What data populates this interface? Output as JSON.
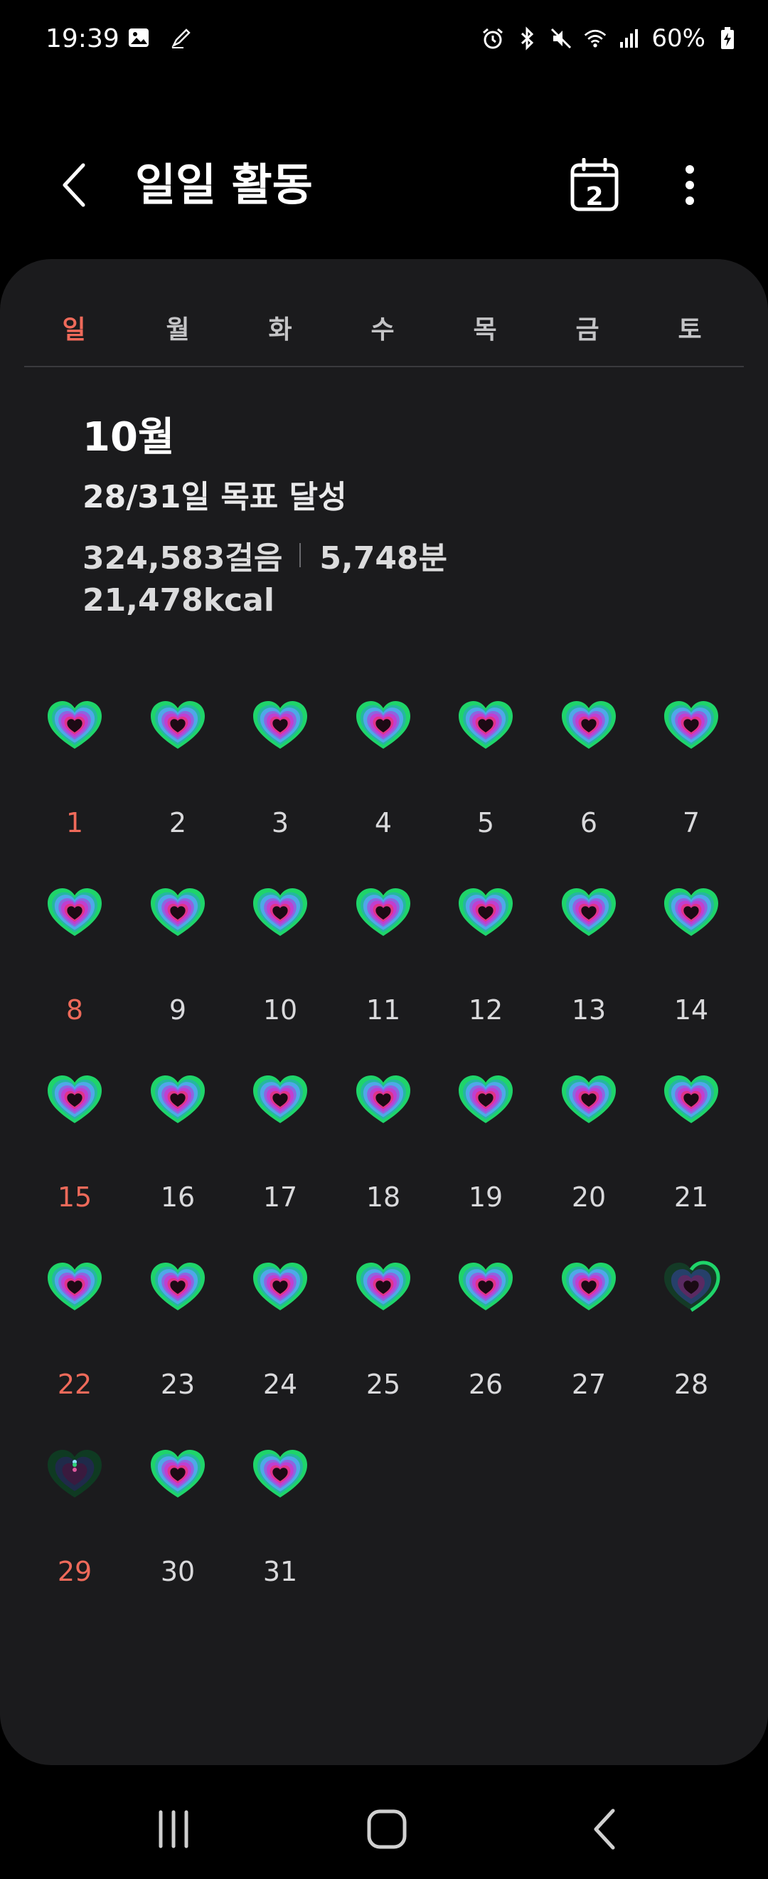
{
  "status_bar": {
    "time": "19:39",
    "battery": "60%",
    "left_icons": [
      "image-icon",
      "pen-icon"
    ],
    "right_icons": [
      "alarm-icon",
      "bluetooth-icon",
      "mute-icon",
      "wifi-icon",
      "signal-icon",
      "battery-charging-icon"
    ]
  },
  "app_bar": {
    "title": "일일 활동",
    "calendar_day": "2"
  },
  "weekdays": [
    "일",
    "월",
    "화",
    "수",
    "목",
    "금",
    "토"
  ],
  "summary": {
    "month": "10월",
    "goal": "28/31일 목표 달성",
    "steps": "324,583걸음",
    "minutes": "5,748분",
    "kcal": "21,478kcal"
  },
  "calendar": {
    "days": [
      {
        "label": "1",
        "status": "full"
      },
      {
        "label": "2",
        "status": "full"
      },
      {
        "label": "3",
        "status": "full"
      },
      {
        "label": "4",
        "status": "full"
      },
      {
        "label": "5",
        "status": "full"
      },
      {
        "label": "6",
        "status": "full"
      },
      {
        "label": "7",
        "status": "full"
      },
      {
        "label": "8",
        "status": "full"
      },
      {
        "label": "9",
        "status": "full"
      },
      {
        "label": "10",
        "status": "full"
      },
      {
        "label": "11",
        "status": "full"
      },
      {
        "label": "12",
        "status": "full"
      },
      {
        "label": "13",
        "status": "full"
      },
      {
        "label": "14",
        "status": "full"
      },
      {
        "label": "15",
        "status": "full"
      },
      {
        "label": "16",
        "status": "full"
      },
      {
        "label": "17",
        "status": "full"
      },
      {
        "label": "18",
        "status": "full"
      },
      {
        "label": "19",
        "status": "full"
      },
      {
        "label": "20",
        "status": "full"
      },
      {
        "label": "21",
        "status": "full"
      },
      {
        "label": "22",
        "status": "full"
      },
      {
        "label": "23",
        "status": "full"
      },
      {
        "label": "24",
        "status": "full"
      },
      {
        "label": "25",
        "status": "full"
      },
      {
        "label": "26",
        "status": "full"
      },
      {
        "label": "27",
        "status": "full"
      },
      {
        "label": "28",
        "status": "partial"
      },
      {
        "label": "29",
        "status": "low"
      },
      {
        "label": "30",
        "status": "full"
      },
      {
        "label": "31",
        "status": "full"
      }
    ]
  },
  "colors": {
    "background": "#000000",
    "card": "#1b1b1d",
    "sunday": "#ef6a5a",
    "ring_outer": "#1fd46a",
    "ring_middle": "#4fa8e8",
    "ring_inner": "#c03fd0"
  },
  "nav_icons": [
    "recent-apps-icon",
    "home-icon",
    "back-nav-icon"
  ]
}
